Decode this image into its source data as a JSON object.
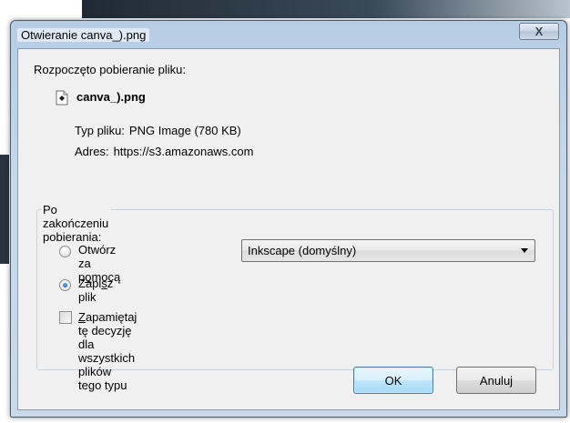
{
  "dialog": {
    "title": "Otwieranie canva_).png",
    "close_label": "X"
  },
  "download": {
    "intro": "Rozpoczęto pobieranie pliku:",
    "file_name": "canva_).png",
    "type_label": "Typ pliku:",
    "type_value": "PNG Image (780 KB)",
    "address_label": "Adres:",
    "address_value": "https://s3.amazonaws.com"
  },
  "after_download": {
    "legend": "Po zakończeniu pobierania:",
    "open_with": {
      "label_before": "Otwórz za p",
      "label_accel": "o",
      "label_after": "mocą",
      "selected": false
    },
    "app_select": {
      "value": "Inkscape (domyślny)"
    },
    "save_file": {
      "label_before": "Zapi",
      "label_accel": "s",
      "label_after": "z plik",
      "selected": true
    },
    "remember": {
      "label_before": "",
      "label_accel": "Z",
      "label_after": "apamiętaj tę decyzję dla wszystkich plików tego typu",
      "checked": false
    }
  },
  "buttons": {
    "ok": "OK",
    "cancel": "Anuluj"
  }
}
